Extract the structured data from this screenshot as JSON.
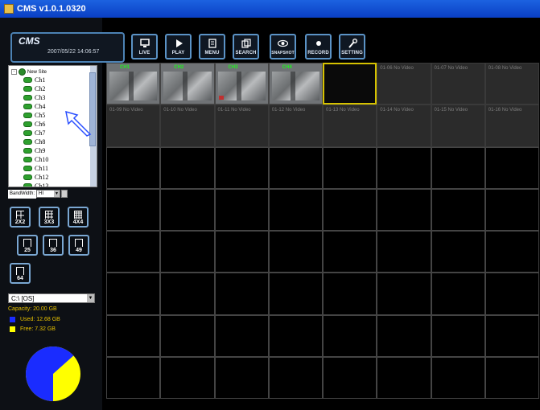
{
  "window": {
    "title": "CMS v1.0.1.0320"
  },
  "header": {
    "logo": "CMS",
    "datetime": "2007/05/22 14:06:57"
  },
  "toolbar": [
    {
      "label": "LIVE",
      "icon": "monitor-icon"
    },
    {
      "label": "PLAY",
      "icon": "play-icon"
    },
    {
      "label": "MENU",
      "icon": "menu-icon"
    },
    {
      "label": "SEARCH",
      "icon": "search-icon"
    },
    {
      "label": "SNAPSHOT",
      "icon": "eye-icon"
    },
    {
      "label": "RECORD",
      "icon": "record-icon"
    },
    {
      "label": "SETTING",
      "icon": "wrench-icon"
    }
  ],
  "tree": {
    "root": "New Site",
    "channels": [
      "Ch1",
      "Ch2",
      "Ch3",
      "Ch4",
      "Ch5",
      "Ch6",
      "Ch7",
      "Ch8",
      "Ch9",
      "Ch10",
      "Ch11",
      "Ch12",
      "Ch13"
    ]
  },
  "bandwidth": {
    "label": "BandWidth:",
    "value": "HI"
  },
  "layouts": [
    "2X2",
    "3X3",
    "4X4",
    "25",
    "36",
    "49",
    "64"
  ],
  "disk": {
    "drive": "C:\\ [OS]",
    "capacity": "Capacity: 20.00 GB",
    "used": "Used: 12.68 GB",
    "free": "Free: 7.32 GB",
    "used_fraction": 0.634,
    "used_color": "#1a2cff",
    "free_color": "#ffff00"
  },
  "grid": {
    "live_cells": [
      {
        "tag": "CH1"
      },
      {
        "tag": "CH2"
      },
      {
        "tag": "CH3"
      },
      {
        "tag": "CH4"
      }
    ],
    "no_video_row1": [
      "01-06 No Video",
      "01-07 No Video",
      "01-08 No Video"
    ],
    "no_video_row2": [
      "01-09 No Video",
      "01-10 No Video",
      "01-11 No Video",
      "01-12 No Video",
      "01-13 No Video",
      "01-14 No Video",
      "01-15 No Video",
      "01-16 No Video"
    ]
  }
}
